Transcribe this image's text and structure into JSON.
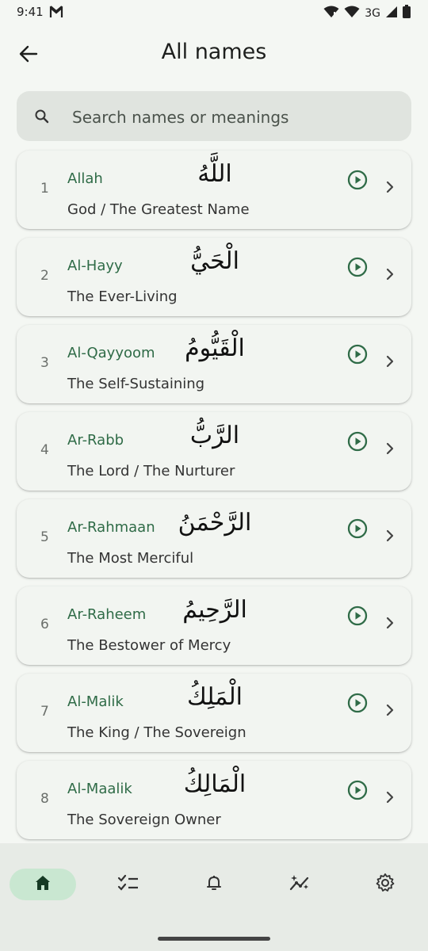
{
  "status": {
    "time": "9:41",
    "network": "3G"
  },
  "header": {
    "title": "All names"
  },
  "search": {
    "placeholder": "Search names or meanings"
  },
  "names": [
    {
      "number": "1",
      "translit": "Allah",
      "arabic": "اللَّهُ",
      "meaning": "God / The Greatest Name"
    },
    {
      "number": "2",
      "translit": "Al-Hayy",
      "arabic": "الْحَيُّ",
      "meaning": "The Ever-Living"
    },
    {
      "number": "3",
      "translit": "Al-Qayyoom",
      "arabic": "الْقَيُّومُ",
      "meaning": "The Self-Sustaining"
    },
    {
      "number": "4",
      "translit": "Ar-Rabb",
      "arabic": "الرَّبُّ",
      "meaning": "The Lord / The Nurturer"
    },
    {
      "number": "5",
      "translit": "Ar-Rahmaan",
      "arabic": "الرَّحْمَنُ",
      "meaning": "The Most Merciful"
    },
    {
      "number": "6",
      "translit": "Ar-Raheem",
      "arabic": "الرَّحِيمُ",
      "meaning": "The Bestower of Mercy"
    },
    {
      "number": "7",
      "translit": "Al-Malik",
      "arabic": "الْمَلِكُ",
      "meaning": "The King / The Sovereign"
    },
    {
      "number": "8",
      "translit": "Al-Maalik",
      "arabic": "الْمَالِكُ",
      "meaning": "The Sovereign Owner"
    }
  ],
  "nav": {
    "items": [
      {
        "icon": "home-icon",
        "active": true
      },
      {
        "icon": "checklist-icon",
        "active": false
      },
      {
        "icon": "bell-icon",
        "active": false
      },
      {
        "icon": "sparkle-chart-icon",
        "active": false
      },
      {
        "icon": "gear-icon",
        "active": false
      }
    ]
  },
  "colors": {
    "accent": "#2f6b47",
    "background": "#f4f7f3",
    "card": "#f2f5f1",
    "nav_active": "#c9e7d1"
  }
}
